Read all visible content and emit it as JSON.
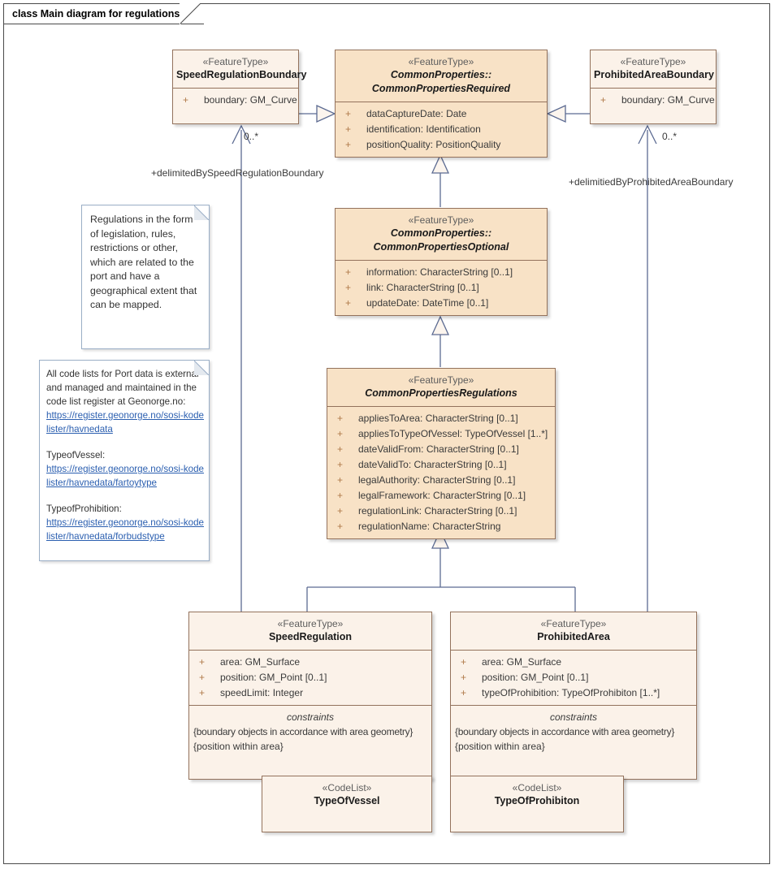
{
  "frame": {
    "title": "class Main diagram for regulations"
  },
  "colors": {
    "class_fill_tan": "#f8e2c6",
    "class_fill_pale": "#fdf6ef",
    "class_border": "#93725c",
    "connector": "#5c6b92",
    "note_border": "#9aaec6",
    "link_text": "#2b5fb0",
    "frame_border": "#4a4a4a"
  },
  "classes": {
    "speed_regulation_boundary": {
      "stereotype": "«FeatureType»",
      "name": "SpeedRegulationBoundary",
      "attributes": [
        {
          "visibility": "+",
          "text": "boundary: GM_Curve"
        }
      ]
    },
    "common_properties_required": {
      "stereotype": "«FeatureType»",
      "name_line1": "CommonProperties::",
      "name_line2": "CommonPropertiesRequired",
      "attributes": [
        {
          "visibility": "+",
          "text": "dataCaptureDate: Date"
        },
        {
          "visibility": "+",
          "text": "identification: Identification"
        },
        {
          "visibility": "+",
          "text": "positionQuality: PositionQuality"
        }
      ]
    },
    "prohibited_area_boundary": {
      "stereotype": "«FeatureType»",
      "name": "ProhibitedAreaBoundary",
      "attributes": [
        {
          "visibility": "+",
          "text": "boundary: GM_Curve"
        }
      ]
    },
    "common_properties_optional": {
      "stereotype": "«FeatureType»",
      "name_line1": "CommonProperties::",
      "name_line2": "CommonPropertiesOptional",
      "attributes": [
        {
          "visibility": "+",
          "text": "information: CharacterString [0..1]"
        },
        {
          "visibility": "+",
          "text": "link: CharacterString [0..1]"
        },
        {
          "visibility": "+",
          "text": "updateDate: DateTime [0..1]"
        }
      ]
    },
    "common_properties_regulations": {
      "stereotype": "«FeatureType»",
      "name": "CommonPropertiesRegulations",
      "attributes": [
        {
          "visibility": "+",
          "text": "appliesToArea: CharacterString [0..1]"
        },
        {
          "visibility": "+",
          "text": "appliesToTypeOfVessel: TypeOfVessel [1..*]"
        },
        {
          "visibility": "+",
          "text": "dateValidFrom: CharacterString [0..1]"
        },
        {
          "visibility": "+",
          "text": "dateValidTo: CharacterString [0..1]"
        },
        {
          "visibility": "+",
          "text": "legalAuthority: CharacterString [0..1]"
        },
        {
          "visibility": "+",
          "text": "legalFramework: CharacterString [0..1]"
        },
        {
          "visibility": "+",
          "text": "regulationLink: CharacterString [0..1]"
        },
        {
          "visibility": "+",
          "text": "regulationName: CharacterString"
        }
      ]
    },
    "speed_regulation": {
      "stereotype": "«FeatureType»",
      "name": "SpeedRegulation",
      "attributes": [
        {
          "visibility": "+",
          "text": "area: GM_Surface"
        },
        {
          "visibility": "+",
          "text": "position: GM_Point [0..1]"
        },
        {
          "visibility": "+",
          "text": "speedLimit: Integer"
        }
      ],
      "constraints_title": "constraints",
      "constraints": [
        "{boundary objects in accordance with area geometry}",
        "{position within area}"
      ]
    },
    "prohibited_area": {
      "stereotype": "«FeatureType»",
      "name": "ProhibitedArea",
      "attributes": [
        {
          "visibility": "+",
          "text": "area: GM_Surface"
        },
        {
          "visibility": "+",
          "text": "position: GM_Point [0..1]"
        },
        {
          "visibility": "+",
          "text": "typeOfProhibition: TypeOfProhibiton [1..*]"
        }
      ],
      "constraints_title": "constraints",
      "constraints": [
        "{boundary objects in accordance with area geometry}",
        "{position within area}"
      ]
    },
    "type_of_vessel": {
      "stereotype": "«CodeList»",
      "name": "TypeOfVessel"
    },
    "type_of_prohibiton": {
      "stereotype": "«CodeList»",
      "name": "TypeOfProhibiton"
    }
  },
  "notes": {
    "regulations_note": {
      "text": "Regulations in the form of legislation, rules, restrictions or other, which are related to the port and have a geographical extent that can be mapped."
    },
    "codelist_note": {
      "intro": "All code lists for Port data is external and managed and maintained in the code list register at Geonorge.no:",
      "intro_link": "https://register.geonorge.no/sosi-kodelister/havnedata",
      "vessel_label": "TypeofVessel:",
      "vessel_link": "https://register.geonorge.no/sosi-kodelister/havnedata/fartoytype",
      "prohibition_label": "TypeofProhibition:",
      "prohibition_link": "https://register.geonorge.no/sosi-kodelister/havnedata/forbudstype"
    }
  },
  "connectors": {
    "speed_assoc_label": "+delimitedBySpeedRegulationBoundary",
    "speed_assoc_mult": "0..*",
    "prohibited_assoc_label": "+delimitiedByProhibitedAreaBoundary",
    "prohibited_assoc_mult": "0..*"
  }
}
